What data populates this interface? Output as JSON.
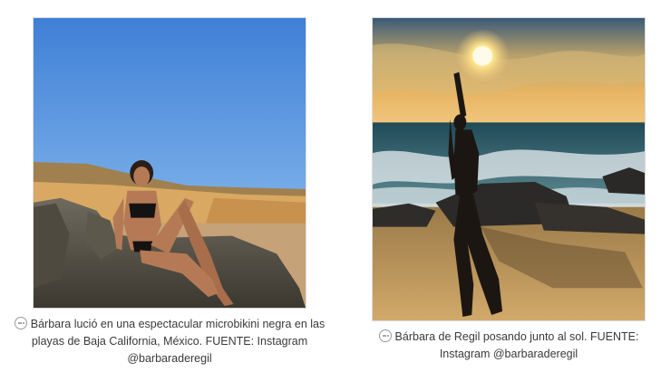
{
  "figures": [
    {
      "caption_text": "Bárbara lució en una espectacular microbikini negra en las playas de Baja California, México. FUENTE: Instagram @barbaraderegil",
      "caption_icon": "more-dots-icon"
    },
    {
      "caption_text": "Bárbara de Regil posando junto al sol. FUENTE: Instagram @barbaraderegil",
      "caption_icon": "more-dots-icon"
    }
  ]
}
